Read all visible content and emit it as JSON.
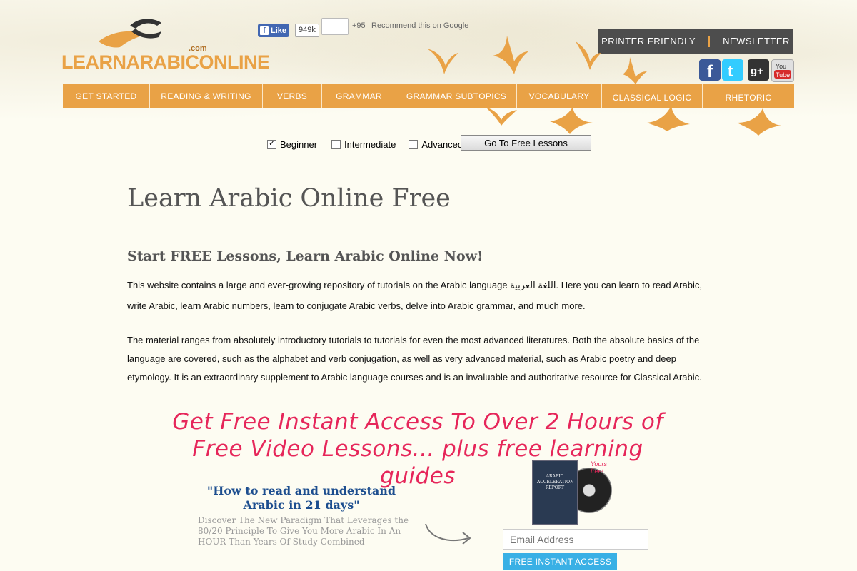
{
  "brand": {
    "logo_text_part1": "LEARN",
    "logo_text_part2": "ARABIC",
    "logo_text_part3": "ONLINE",
    "logo_com": ".com"
  },
  "social_top": {
    "fb_like_label": "Like",
    "fb_count": "949k",
    "gplus_count": "+95",
    "gplus_text": "Recommend this on Google"
  },
  "util_bar": {
    "printer": "PRINTER FRIENDLY",
    "newsletter": "NEWSLETTER"
  },
  "social_icons": [
    "facebook-icon",
    "twitter-icon",
    "google-plus-icon",
    "youtube-icon"
  ],
  "nav": {
    "items": [
      {
        "label": "Get Started"
      },
      {
        "label": "Reading & Writing"
      },
      {
        "label": "Verbs"
      },
      {
        "label": "Grammar"
      },
      {
        "label": "Grammar Subtopics"
      },
      {
        "label": "Vocabulary"
      },
      {
        "label": "Classical Logic"
      },
      {
        "label": "Rhetoric"
      }
    ]
  },
  "levels": {
    "options": [
      {
        "label": "Beginner",
        "checked": true
      },
      {
        "label": "Intermediate",
        "checked": false
      },
      {
        "label": "Advanced",
        "checked": false
      }
    ],
    "go_button": "Go To Free Lessons"
  },
  "main": {
    "title": "Learn Arabic Online Free",
    "subtitle": "Start FREE Lessons, Learn Arabic Online Now!",
    "para1": "This website contains a large and ever-growing repository of tutorials on the Arabic language اللغة العربية. Here you can learn to read Arabic, write Arabic, learn Arabic numbers, learn to conjugate Arabic verbs, delve into Arabic grammar, and much more.",
    "para2": "The material ranges from absolutely introductory tutorials to tutorials for even the most advanced literatures. Both the absolute basics of the language are covered, such as the alphabet and verb conjugation, as well as very advanced material, such as Arabic poetry and deep etymology. It is an extraordinary supplement to Arabic language courses and is an invaluable and authoritative resource for Classical Arabic."
  },
  "promo": {
    "headline_line1": "Get Free Instant Access To Over 2 Hours of",
    "headline_line2": "Free Video Lessons... plus free learning guides",
    "quote_title": "\"How to read and understand Arabic in 21 days\"",
    "quote_sub": "Discover The New Paradigm That Leverages the 80/20 Principle To Give You More Arabic In An HOUR Than Years Of Study Combined",
    "dvd_label": "ARABIC ACCELERATION REPORT",
    "dvd_free": "Yours free!",
    "email_placeholder": "Email Address",
    "button": "FREE INSTANT ACCESS"
  },
  "colors": {
    "accent": "#e9a246",
    "dark_bar": "#4d4d4d",
    "promo_pink": "#e6265a",
    "promo_blue": "#1d4e8f",
    "button_blue": "#39b0e5"
  }
}
